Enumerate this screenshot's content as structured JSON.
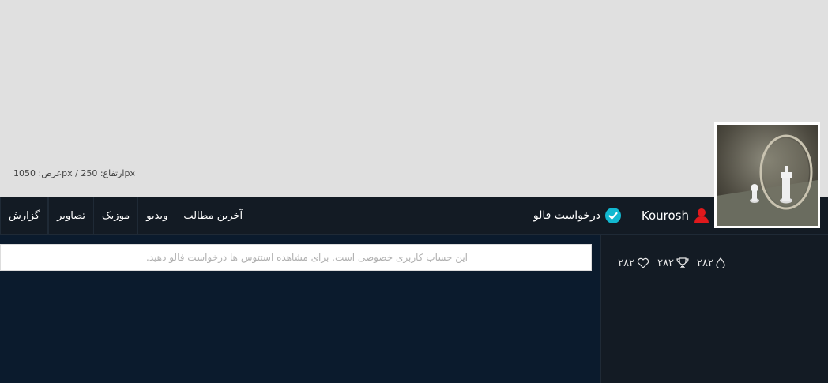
{
  "cover": {
    "dimensions_text": "عرض: 1050px / ارتفاع: 250px"
  },
  "profile": {
    "username": "Kourosh",
    "follow_label": "درخواست فالو"
  },
  "tabs": [
    "آخرین مطالب",
    "ویدیو",
    "موزیک",
    "تصاویر",
    "گزارش"
  ],
  "stats": {
    "drops": "۲۸۲",
    "trophies": "۲۸۲",
    "likes": "۲۸۲"
  },
  "notice": {
    "text": "این حساب کاربری خصوصی است. برای مشاهده استتوس ها درخواست فالو دهید."
  },
  "colors": {
    "user_icon": "#e0191c",
    "follow_badge": "#12b8d0",
    "page_bg": "#0b1b2d",
    "bar_bg": "#131b24"
  }
}
